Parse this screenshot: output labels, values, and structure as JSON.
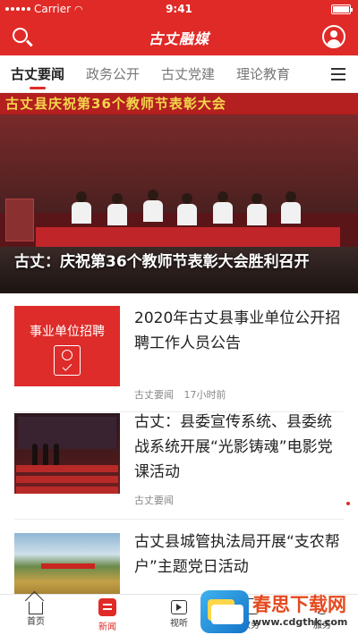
{
  "status_bar": {
    "carrier": "Carrier",
    "time": "9:41"
  },
  "header": {
    "app_title": "古丈融媒"
  },
  "tabs": [
    {
      "label": "古丈要闻",
      "active": true
    },
    {
      "label": "政务公开",
      "active": false
    },
    {
      "label": "古丈党建",
      "active": false
    },
    {
      "label": "理论教育",
      "active": false
    }
  ],
  "banner": {
    "backdrop_text": "古丈县庆祝第36个教师节表彰大会",
    "caption": "古丈：庆祝第36个教师节表彰大会胜利召开"
  },
  "news": [
    {
      "thumb_label": "事业单位招聘",
      "title": "2020年古丈县事业单位公开招聘工作人员公告",
      "source": "古丈要闻",
      "time": "17小时前"
    },
    {
      "title": "古丈：县委宣传系统、县委统战系统开展“光影铸魂”电影党课活动",
      "source": "古丈要闻",
      "time": ""
    },
    {
      "title": "古丈县城管执法局开展“支农帮户”主题党日活动",
      "source": "",
      "time": ""
    }
  ],
  "bottom_nav": [
    {
      "label": "首页",
      "icon": "home-icon",
      "active": false
    },
    {
      "label": "新闻",
      "icon": "news-icon",
      "active": true
    },
    {
      "label": "视听",
      "icon": "video-icon",
      "active": false
    },
    {
      "label": "政务",
      "icon": "gov-icon",
      "active": false
    },
    {
      "label": "服务",
      "icon": "service-icon",
      "active": false
    }
  ],
  "watermark": {
    "brand": "春思下载网",
    "url": "www.cdgthk.com"
  },
  "colors": {
    "brand_red": "#e02a27",
    "text": "#222222",
    "meta": "#888888"
  }
}
